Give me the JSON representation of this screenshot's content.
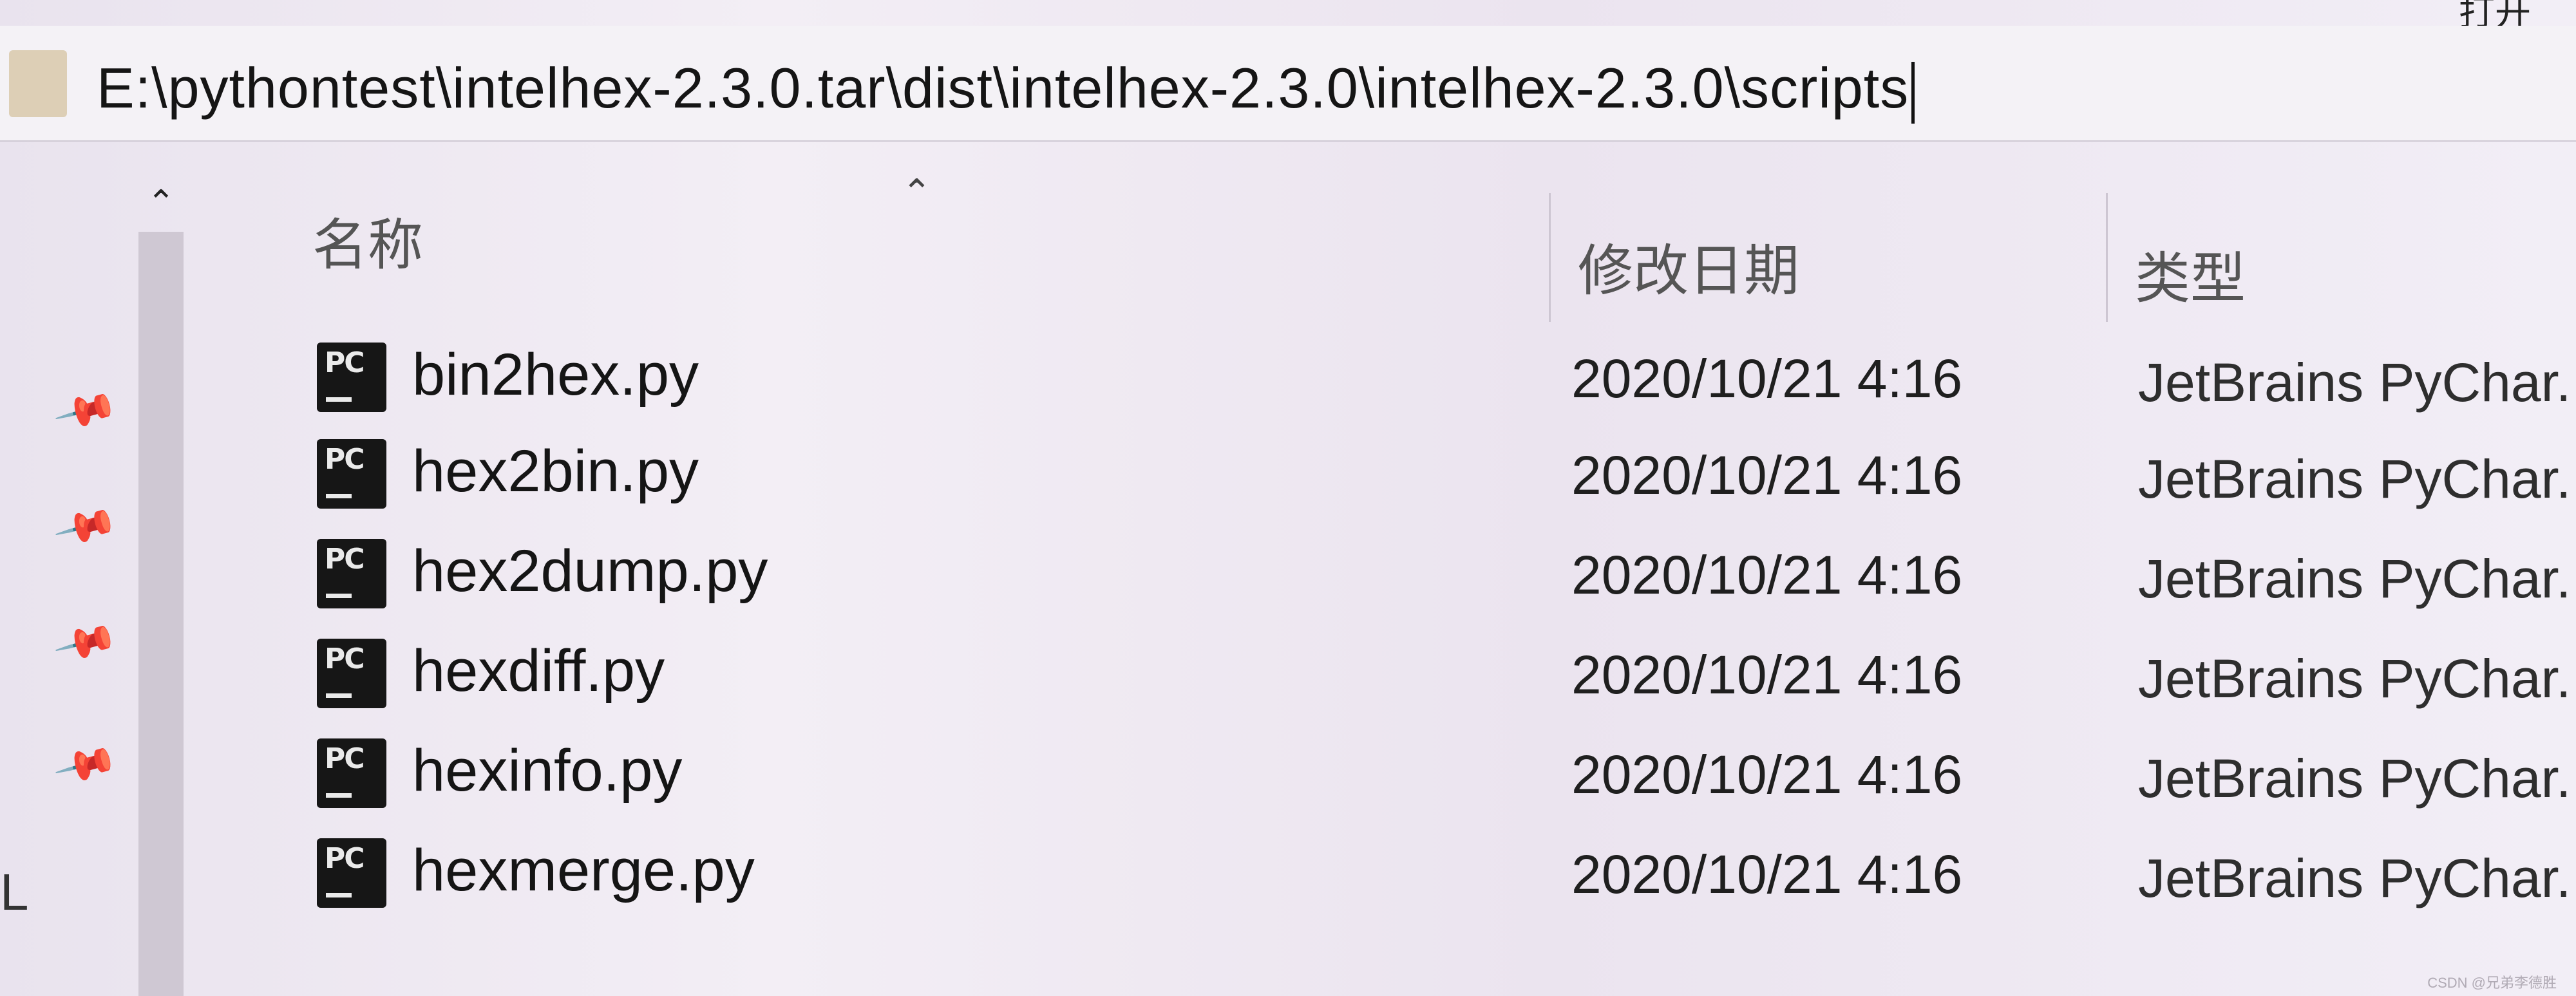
{
  "window": {
    "title_fragment": "打开"
  },
  "address_bar": {
    "path": "E:\\pythontest\\intelhex-2.3.0.tar\\dist\\intelhex-2.3.0\\intelhex-2.3.0\\scripts"
  },
  "columns": {
    "name": "名称",
    "modified": "修改日期",
    "type": "类型"
  },
  "files": [
    {
      "name": "bin2hex.py",
      "modified": "2020/10/21 4:16",
      "type": "JetBrains PyChar."
    },
    {
      "name": "hex2bin.py",
      "modified": "2020/10/21 4:16",
      "type": "JetBrains PyChar."
    },
    {
      "name": "hex2dump.py",
      "modified": "2020/10/21 4:16",
      "type": "JetBrains PyChar."
    },
    {
      "name": "hexdiff.py",
      "modified": "2020/10/21 4:16",
      "type": "JetBrains PyChar."
    },
    {
      "name": "hexinfo.py",
      "modified": "2020/10/21 4:16",
      "type": "JetBrains PyChar."
    },
    {
      "name": "hexmerge.py",
      "modified": "2020/10/21 4:16",
      "type": "JetBrains PyChar."
    }
  ],
  "file_icon_label": "PC",
  "left_mark": "L",
  "watermark": "CSDN @兄弟李德胜",
  "icons": {
    "folder": "folder-icon",
    "pin": "pin-icon",
    "file": "pycharm-file-icon"
  }
}
